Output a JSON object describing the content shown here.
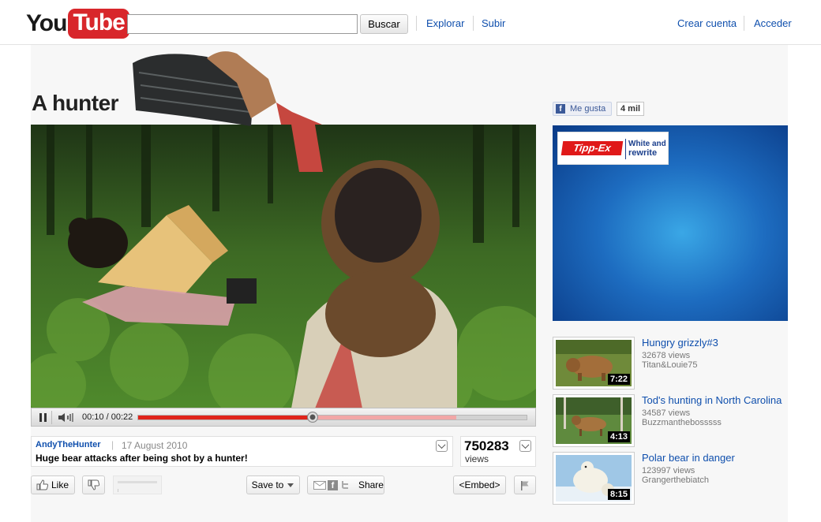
{
  "header": {
    "logo_you": "You",
    "logo_tube": "Tube",
    "search_value": "",
    "search_button": "Buscar",
    "nav": [
      "Explorar",
      "Subir"
    ],
    "create_account": "Crear cuenta",
    "sign_in": "Acceder"
  },
  "video": {
    "title": "A hunter",
    "current_time": "00:10",
    "total_time": "00:22",
    "time_separator": " / ",
    "progress_played_fraction": 0.45,
    "progress_buffered_fraction": 0.82,
    "uploader": "AndyTheHunter",
    "date_separator": "|",
    "upload_date": "17 August 2010",
    "description": "Huge bear attacks after being shot by a hunter!",
    "views": "750283",
    "views_label": "views"
  },
  "actions": {
    "like": "Like",
    "save_to": "Save to",
    "share": "Share",
    "embed": "<Embed>"
  },
  "facebook": {
    "like_label": "Me gusta",
    "count": "4 mil"
  },
  "ad": {
    "brand": "Tipp-Ex",
    "tagline_1": "White and",
    "tagline_2": "rewrite"
  },
  "related": [
    {
      "title": "Hungry grizzly#3",
      "views": "32678 views",
      "user": "Titan&Louie75",
      "duration": "7:22"
    },
    {
      "title": "Tod's hunting in North Carolina",
      "views": "34587 views",
      "user": "Buzzmanthebosssss",
      "duration": "4:13"
    },
    {
      "title": "Polar bear in danger",
      "views": "123997 views",
      "user": "Grangerthebiatch",
      "duration": "8:15"
    }
  ],
  "colors": {
    "link": "#0f4fad",
    "brand_red": "#d8262b",
    "progress_red": "#e0241b",
    "facebook_blue": "#3b5998"
  }
}
